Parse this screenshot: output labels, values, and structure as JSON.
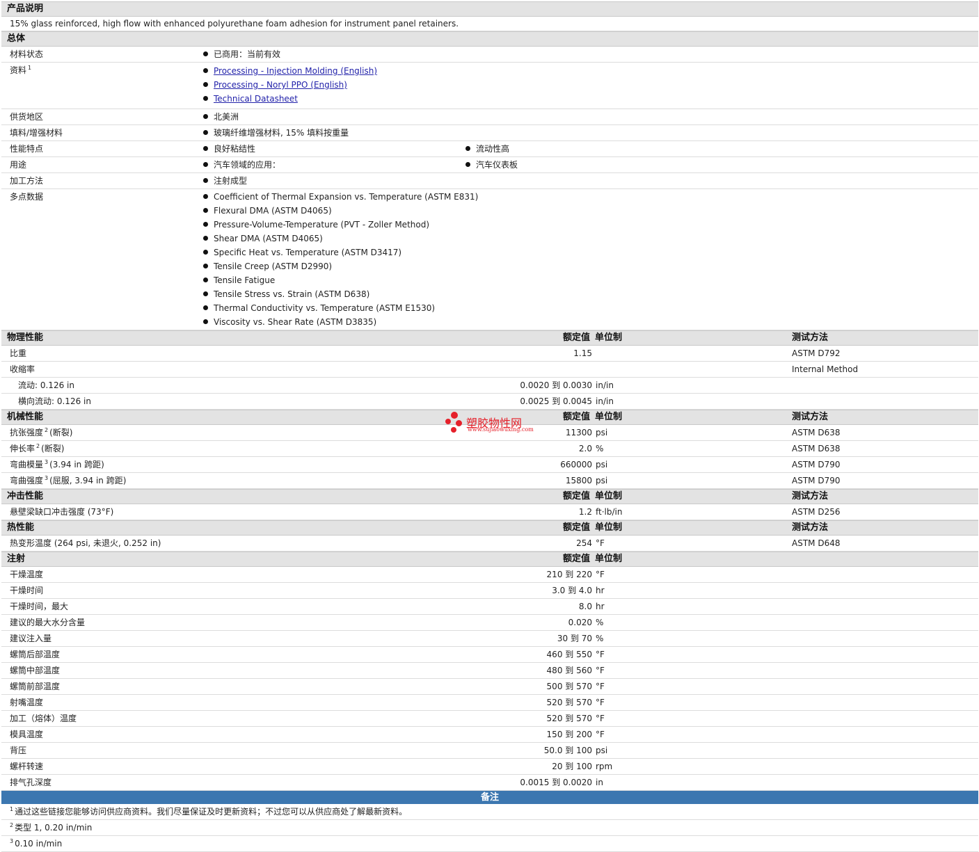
{
  "product_description": {
    "header": "产品说明",
    "text": "15% glass reinforced, high flow with enhanced polyurethane foam adhesion for instrument panel retainers."
  },
  "general": {
    "header": "总体",
    "material_status_label": "材料状态",
    "material_status_value": "已商用：当前有效",
    "documents_label": "资料",
    "documents_sup": "1",
    "documents": [
      "Processing - Injection Molding (English)",
      "Processing - Noryl PPO (English)",
      "Technical Datasheet"
    ],
    "region_label": "供货地区",
    "region_value": "北美洲",
    "filler_label": "填料/增强材料",
    "filler_value": "玻璃纤维增强材料, 15% 填料按重量",
    "features_label": "性能特点",
    "features": [
      "良好粘结性",
      "流动性高"
    ],
    "uses_label": "用途",
    "uses": [
      "汽车领域的应用：",
      "汽车仪表板"
    ],
    "processing_label": "加工方法",
    "processing_value": "注射成型",
    "multipoint_label": "多点数据",
    "multipoint": [
      "Coefficient of Thermal Expansion vs. Temperature (ASTM E831)",
      "Flexural DMA (ASTM D4065)",
      "Pressure-Volume-Temperature (PVT - Zoller Method)",
      "Shear DMA (ASTM D4065)",
      "Specific Heat vs. Temperature (ASTM D3417)",
      "Tensile Creep (ASTM D2990)",
      "Tensile Fatigue",
      "Tensile Stress vs. Strain (ASTM D638)",
      "Thermal Conductivity vs. Temperature (ASTM E1530)",
      "Viscosity vs. Shear Rate (ASTM D3835)"
    ]
  },
  "col_headers": {
    "value": "额定值",
    "unit": "单位制",
    "method": "测试方法"
  },
  "physical": {
    "header": "物理性能",
    "rows": [
      {
        "label": "比重",
        "value": "1.15",
        "unit": "",
        "method": "ASTM D792"
      },
      {
        "label": "收缩率",
        "value": "",
        "unit": "",
        "method": "Internal Method"
      },
      {
        "label": "流动: 0.126 in",
        "value": "0.0020 到  0.0030",
        "unit": "in/in",
        "method": ""
      },
      {
        "label": "横向流动: 0.126 in",
        "value": "0.0025 到  0.0045",
        "unit": "in/in",
        "method": ""
      }
    ]
  },
  "mechanical": {
    "header": "机械性能",
    "rows": [
      {
        "label": "抗张强度",
        "sup": "2",
        "suffix": "(断裂)",
        "value": "11300",
        "unit": "psi",
        "method": "ASTM D638"
      },
      {
        "label": "伸长率",
        "sup": "2",
        "suffix": "(断裂)",
        "value": "2.0",
        "unit": "%",
        "method": "ASTM D638"
      },
      {
        "label": "弯曲模量",
        "sup": "3",
        "suffix": "(3.94 in 跨距)",
        "value": "660000",
        "unit": "psi",
        "method": "ASTM D790"
      },
      {
        "label": "弯曲强度",
        "sup": "3",
        "suffix": "(屈服, 3.94 in 跨距)",
        "value": "15800",
        "unit": "psi",
        "method": "ASTM D790"
      }
    ]
  },
  "impact": {
    "header": "冲击性能",
    "rows": [
      {
        "label": "悬壁梁缺口冲击强度  (73°F)",
        "value": "1.2",
        "unit": "ft·lb/in",
        "method": "ASTM D256"
      }
    ]
  },
  "thermal": {
    "header": "热性能",
    "rows": [
      {
        "label": "热变形温度  (264 psi, 未退火, 0.252 in)",
        "value": "254",
        "unit": "°F",
        "method": "ASTM D648"
      }
    ]
  },
  "injection": {
    "header": "注射",
    "rows": [
      {
        "label": "干燥温度",
        "value": "210 到  220",
        "unit": "°F"
      },
      {
        "label": "干燥时间",
        "value": "3.0 到  4.0",
        "unit": "hr"
      },
      {
        "label": "干燥时间，最大",
        "value": "8.0",
        "unit": "hr"
      },
      {
        "label": "建议的最大水分含量",
        "value": "0.020",
        "unit": "%"
      },
      {
        "label": "建议注入量",
        "value": "30 到  70",
        "unit": "%"
      },
      {
        "label": "螺筒后部温度",
        "value": "460 到  550",
        "unit": "°F"
      },
      {
        "label": "螺筒中部温度",
        "value": "480 到  560",
        "unit": "°F"
      },
      {
        "label": "螺筒前部温度",
        "value": "500 到  570",
        "unit": "°F"
      },
      {
        "label": "射嘴温度",
        "value": "520 到  570",
        "unit": "°F"
      },
      {
        "label": "加工（熔体）温度",
        "value": "520 到  570",
        "unit": "°F"
      },
      {
        "label": "模具温度",
        "value": "150 到  200",
        "unit": "°F"
      },
      {
        "label": "背压",
        "value": "50.0 到  100",
        "unit": "psi"
      },
      {
        "label": "螺杆转速",
        "value": "20 到  100",
        "unit": "rpm"
      },
      {
        "label": "排气孔深度",
        "value": "0.0015 到  0.0020",
        "unit": "in"
      }
    ]
  },
  "notes": {
    "header": "备注",
    "items": [
      {
        "sup": "1",
        "text": "通过这些链接您能够访问供应商资料。我们尽量保证及时更新资料；不过您可以从供应商处了解最新资料。"
      },
      {
        "sup": "2",
        "text": "类型  1, 0.20 in/min"
      },
      {
        "sup": "3",
        "text": "0.10 in/min"
      }
    ]
  },
  "watermark": {
    "title": "塑胶物性网",
    "url": "www.sujiaowuxing.com",
    "color": "#e5202a"
  }
}
